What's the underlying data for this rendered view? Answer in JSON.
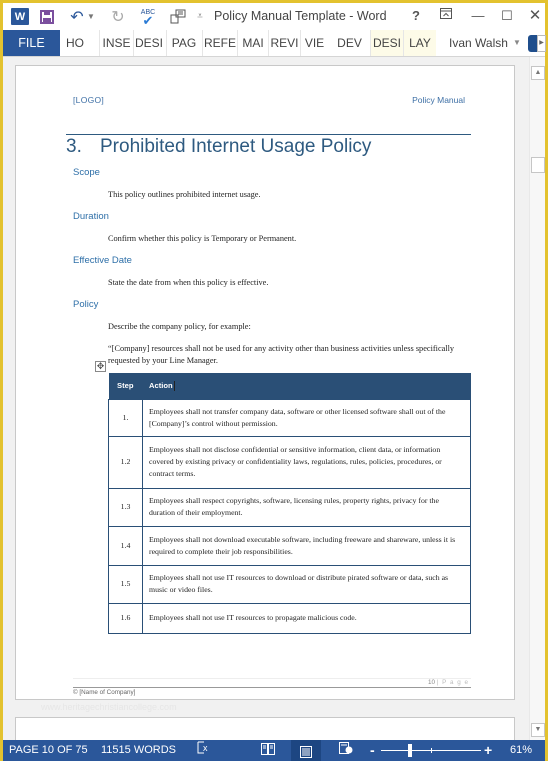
{
  "window": {
    "title": "Policy Manual Template - Word",
    "app_icon": "W",
    "quick_access": [
      "save-icon",
      "undo-icon",
      "redo-icon",
      "spelling-icon",
      "form-icon",
      "customize-icon"
    ],
    "controls": {
      "help": "?",
      "ribbon_options": "⊼",
      "minimize": "—",
      "maximize": "☐",
      "close": "✕"
    }
  },
  "ribbon": {
    "tabs": [
      {
        "label": "FILE",
        "active": true
      },
      {
        "label": "HO"
      },
      {
        "label": "INSE"
      },
      {
        "label": "DESI"
      },
      {
        "label": "PAG"
      },
      {
        "label": "REFE"
      },
      {
        "label": "MAI"
      },
      {
        "label": "REVI"
      },
      {
        "label": "VIE"
      },
      {
        "label": "DEV"
      },
      {
        "label": "DESI",
        "contextual": true
      },
      {
        "label": "LAY",
        "contextual": true
      }
    ],
    "user": "Ivan Walsh"
  },
  "document": {
    "header": {
      "logo": "[LOGO]",
      "title": "Policy Manual"
    },
    "heading": {
      "number": "3.",
      "text": "Prohibited Internet Usage Policy"
    },
    "sections": [
      {
        "title": "Scope",
        "body": "This policy outlines prohibited internet usage."
      },
      {
        "title": "Duration",
        "body": "Confirm whether this policy is Temporary or Permanent."
      },
      {
        "title": "Effective Date",
        "body": "State the date from when this policy is effective."
      },
      {
        "title": "Policy",
        "body": "Describe the company policy, for example:"
      }
    ],
    "quote": "“[Company] resources shall not be used for any activity other than business activities unless specifically requested by your Line Manager.",
    "table": {
      "headers": [
        "Step",
        "Action"
      ],
      "rows": [
        {
          "step": "1.",
          "action": "Employees shall not transfer company data, software or other licensed software shall out of the [Company]’s control without permission."
        },
        {
          "step": "1.2",
          "action": "Employees shall not disclose confidential or sensitive information, client data, or information covered by existing privacy or confidentiality laws, regulations, rules, policies, procedures, or contract terms."
        },
        {
          "step": "1.3",
          "action": "Employees shall respect copyrights, software, licensing rules, property rights, privacy for the duration of their employment."
        },
        {
          "step": "1.4",
          "action": "Employees shall not download executable software, including freeware and shareware, unless it is required to complete their job responsibilities."
        },
        {
          "step": "1.5",
          "action": "Employees shall not use IT resources to download or distribute pirated software or data, such as music or video files."
        },
        {
          "step": "1.6",
          "action": "Employees shall not use IT resources to propagate malicious code."
        }
      ]
    },
    "footer": {
      "page_number": "10",
      "page_label": "| P a g e",
      "copyright": "© [Name of Company]"
    },
    "watermark": "www.heritagechristiancollege.com"
  },
  "status_bar": {
    "page": "PAGE 10 OF 75",
    "words": "11515 WORDS",
    "zoom": "61%",
    "zoom_percent": 61
  },
  "colors": {
    "accent": "#2b579a",
    "heading": "#2e5a80",
    "subheading": "#2e6fa8",
    "table_header": "#2a4f76",
    "window_border": "#e3c22f"
  }
}
